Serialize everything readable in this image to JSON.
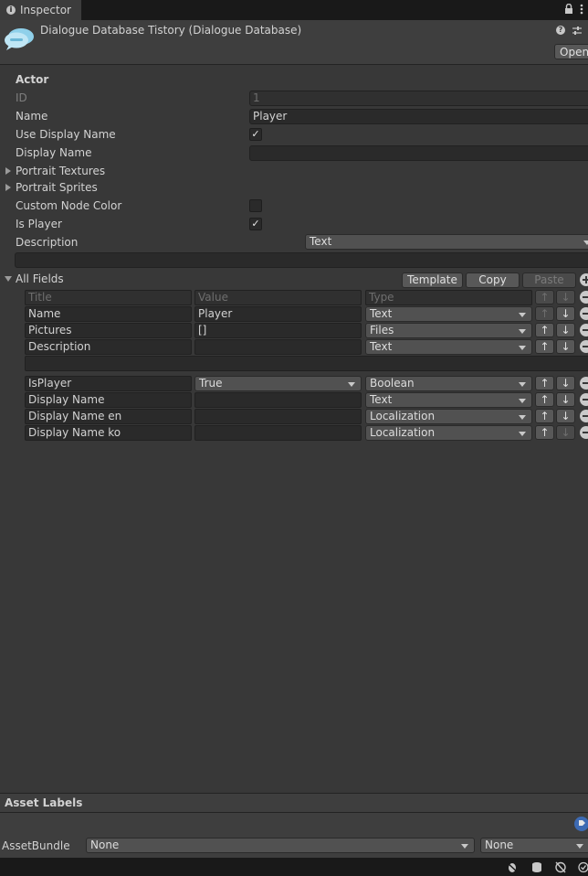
{
  "tab": {
    "label": "Inspector"
  },
  "header": {
    "title": "Dialogue Database Tistory (Dialogue Database)",
    "open_label": "Open"
  },
  "actor": {
    "section_title": "Actor",
    "id_label": "ID",
    "id_value": "1",
    "name_label": "Name",
    "name_value": "Player",
    "use_display_name_label": "Use Display Name",
    "display_name_label": "Display Name",
    "display_name_value": "",
    "portrait_textures_label": "Portrait Textures",
    "portrait_sprites_label": "Portrait Sprites",
    "custom_node_color_label": "Custom Node Color",
    "is_player_label": "Is Player",
    "description_label": "Description",
    "description_type": "Text",
    "description_value": "",
    "checks": {
      "use_display_name": "✓",
      "custom_node_color": "",
      "is_player": "✓"
    }
  },
  "fields": {
    "section_label": "All Fields",
    "template_label": "Template",
    "copy_label": "Copy",
    "paste_label": "Paste",
    "headers": {
      "title": "Title",
      "value": "Value",
      "type": "Type"
    },
    "rows": [
      {
        "title": "Name",
        "value": "Player",
        "type": "Text"
      },
      {
        "title": "Pictures",
        "value": "[]",
        "type": "Files"
      },
      {
        "title": "Description",
        "value": "",
        "type": "Text"
      },
      {
        "title": "IsPlayer",
        "value": "True",
        "type": "Boolean"
      },
      {
        "title": "Display Name",
        "value": "",
        "type": "Text"
      },
      {
        "title": "Display Name en",
        "value": "",
        "type": "Localization"
      },
      {
        "title": "Display Name ko",
        "value": "",
        "type": "Localization"
      }
    ],
    "arrows": {
      "up": "↑",
      "down": "↓"
    }
  },
  "asset_labels": {
    "title": "Asset Labels",
    "assetbundle_label": "AssetBundle",
    "bundle_value": "None",
    "variant_value": "None"
  },
  "icons": {
    "info": "i",
    "lock": "lock-icon",
    "menu": "kebab-icon",
    "help": "?",
    "settings": "sliders-icon"
  }
}
